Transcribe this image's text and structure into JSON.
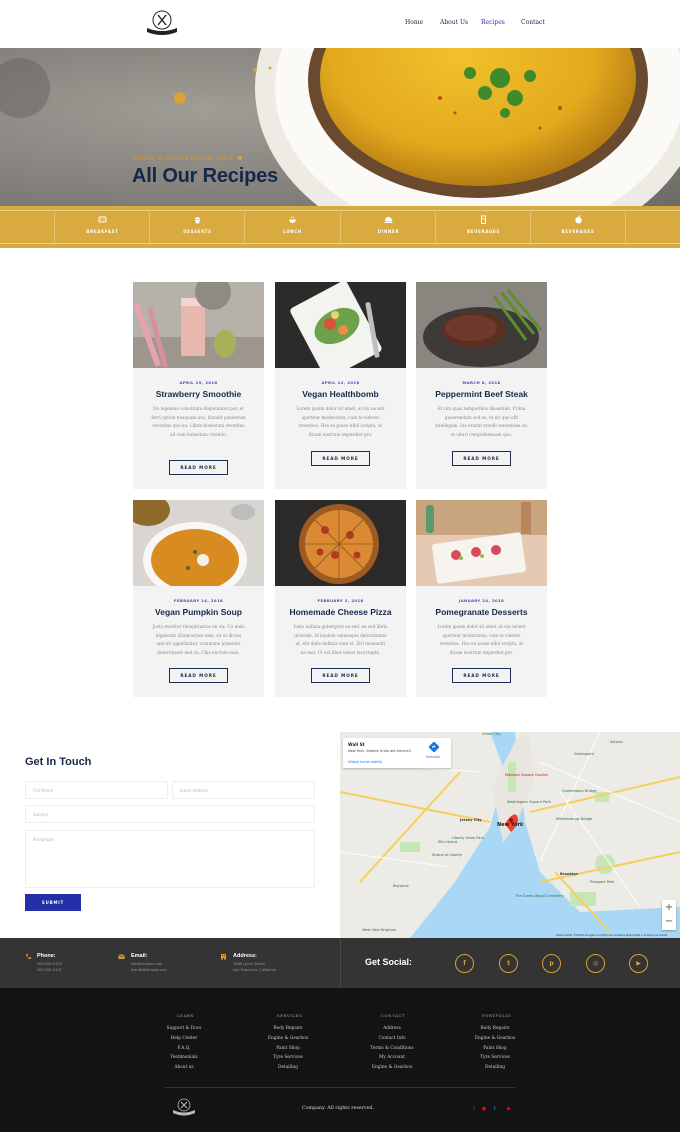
{
  "nav": {
    "items": [
      {
        "label": "Home"
      },
      {
        "label": "About Us"
      },
      {
        "label": "Recipes"
      },
      {
        "label": "Contact"
      }
    ]
  },
  "hero": {
    "kicker": "BROWSE TO SEE OUR AMAZING CHEFS",
    "title": "All Our Recipes"
  },
  "categories": [
    {
      "label": "BREAKFAST",
      "icon": "fork-knife-icon"
    },
    {
      "label": "DESSERTS",
      "icon": "cupcake-icon"
    },
    {
      "label": "LUNCH",
      "icon": "bowl-icon"
    },
    {
      "label": "DINNER",
      "icon": "cloche-icon"
    },
    {
      "label": "BEVERAGES",
      "icon": "drink-icon"
    },
    {
      "label": "BEVERAGES",
      "icon": "apple-icon"
    }
  ],
  "recipes": [
    {
      "date": "APRIL 19, 2018",
      "title": "Strawberry Smoothie",
      "excerpt": "No legendos constituto disputationi per, et ferri option nusquam usu, blandit ponderum reverbus quo eu. Libris honestum reverbus ad cum honestum vivendo.",
      "button": "READ MORE"
    },
    {
      "date": "APRIL 12, 2018",
      "title": "Vegan Healthbomb",
      "excerpt": "Lorem ipsum dolor sit amet, ei vix sucent aperteur moderatius, cum te viderer reverbus. Has ea posse nibil scripta, at dicam nostrum imperdiet pro.",
      "button": "READ MORE"
    },
    {
      "date": "MARCH 6, 2018",
      "title": "Peppermint Beef Steak",
      "excerpt": "Ei vim quas temporibus dissentiet. Prima guaerendum sed ex, te eir quo offt intellegam. Ius eruant ersulit sententiae ex, et vituri comprehensam quo.",
      "button": "READ MORE"
    },
    {
      "date": "FEBRUARY 14, 2018",
      "title": "Vegan Pumpkin Soup",
      "excerpt": "Justo everitur theophrastus an vix. Cu mels dignissim ullamcorper eam, sit ut dictas epicuri appellantur, commune praesent deterruisset mel cu. Chis noctum eum.",
      "button": "READ MORE"
    },
    {
      "date": "FEBRUARY 2, 2018",
      "title": "Homemade Cheese Pizza",
      "excerpt": "Iusto nullam gubergren eu sed, ea sed libris dolorem. Id laudem omnesque delicatissimi ut, elit diele definiis eam et. Zril menandri ne mel. Ut est illud soleat incorrupte.",
      "button": "READ MORE"
    },
    {
      "date": "JANUARY 24, 2018",
      "title": "Pomegranate Desserts",
      "excerpt": "Lorem ipsum dolor sit amet, ei vix sucent aperteur moderatius, cum te viderer reverbus. Has ea posse nibil scripta, at dicam nostrum imperdiet pro.",
      "button": "READ MORE"
    }
  ],
  "contact": {
    "title": "Get In Touch",
    "full_name_placeholder": "Full Name",
    "email_placeholder": "Email Address",
    "subject_placeholder": "Subject",
    "paragraph_placeholder": "Paragraph",
    "submit": "SUBMIT"
  },
  "map": {
    "place": "Wall St",
    "address": "New York, Statele Unite ale Americii",
    "link": "Afișați harta mărită",
    "directions": "Indicații",
    "labels": [
      "Union City",
      "Jersey City",
      "New York",
      "Brooklyn",
      "Bayonne",
      "Madison Square Garden",
      "Washington Square Park",
      "Queensboro Bridge",
      "Williamsburg Bridge",
      "Ellis Island",
      "Statue of Liberty",
      "Prospect Park",
      "The Green-Wood Cemetery",
      "West New Brighton",
      "Liberty State Park",
      "Greenpoint",
      "Astoria"
    ],
    "attribution": "Date hartă ©2020 Google   Condiții de utilizare   Raportați o eroare pe hartă",
    "zoom_in": "+",
    "zoom_out": "−"
  },
  "info": {
    "phone_label": "Phone:",
    "phone_1": "303-555-0123",
    "phone_2": "303-555-0101",
    "email_label": "Email:",
    "email_1": "info@recipes.com",
    "email_2": "tkeuth@recipes.com",
    "address_label": "Address:",
    "address_1": "1066 Lynch Street,",
    "address_2": "San Francisco, California",
    "social_label": "Get Social:",
    "social": [
      {
        "icon": "facebook-icon",
        "glyph": "f"
      },
      {
        "icon": "twitter-icon",
        "glyph": "t"
      },
      {
        "icon": "pinterest-icon",
        "glyph": "p"
      },
      {
        "icon": "instagram-icon",
        "glyph": "◎"
      },
      {
        "icon": "youtube-icon",
        "glyph": "▶"
      }
    ]
  },
  "footer": {
    "columns": [
      {
        "heading": "LEARN",
        "links": [
          "Support & Docs",
          "Help Center",
          "F.A.Q.",
          "Testimonials",
          "About us"
        ]
      },
      {
        "heading": "SERVICES",
        "links": [
          "Body Repairs",
          "Engine & Gearbox",
          "Paint Shop",
          "Tyre Services",
          "Detailing"
        ]
      },
      {
        "heading": "CONTACT",
        "links": [
          "Address",
          "Contact Info",
          "Terms & Conditions",
          "My Account",
          "Engine & Gearbox"
        ]
      },
      {
        "heading": "PORTFOLIO",
        "links": [
          "Body Repairs",
          "Engine & Gearbox",
          "Paint Shop",
          "Tyre Services",
          "Detailing"
        ]
      }
    ],
    "copyright": "Company. All rights reserved."
  },
  "colors": {
    "accent": "#d8aa3f",
    "navy": "#15284b",
    "button_blue": "#2430a8"
  }
}
